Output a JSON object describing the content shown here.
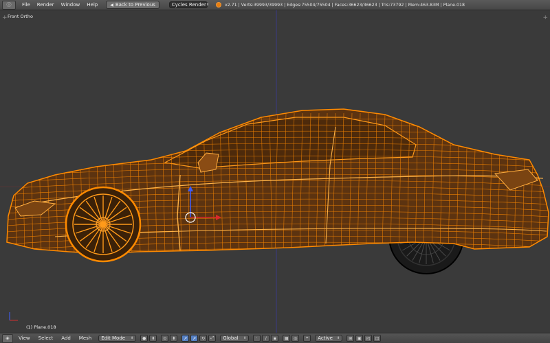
{
  "header": {
    "menus": [
      "File",
      "Render",
      "Window",
      "Help"
    ],
    "back_button": "Back to Previous",
    "render_engine": "Cycles Render",
    "stats": "v2.71 | Verts:39993/39993 | Edges:75504/75504 | Faces:36623/36623 | Tris:73792 | Mem:463.83M | Plane.018"
  },
  "viewport": {
    "view_label": "Front Ortho",
    "object_label": "(1) Plane.018"
  },
  "footer": {
    "menus": [
      "View",
      "Select",
      "Add",
      "Mesh"
    ],
    "mode": "Edit Mode",
    "orientation": "Global",
    "pivot_active": "Active"
  },
  "colors": {
    "background": "#393939",
    "wire": "#ff8a00",
    "wire_selected": "#ffa531",
    "axis_vertical": "#3a3a8a",
    "axis_horizontal": "#6a2a2a"
  },
  "icons": [
    "editor-type-icon",
    "blender-logo-icon",
    "3d-view-icon",
    "viewport-shading-icon",
    "pivot-icon",
    "manipulator-icon",
    "translate-icon",
    "rotate-icon",
    "scale-icon",
    "layers-icon",
    "snap-icon",
    "render-icon"
  ]
}
